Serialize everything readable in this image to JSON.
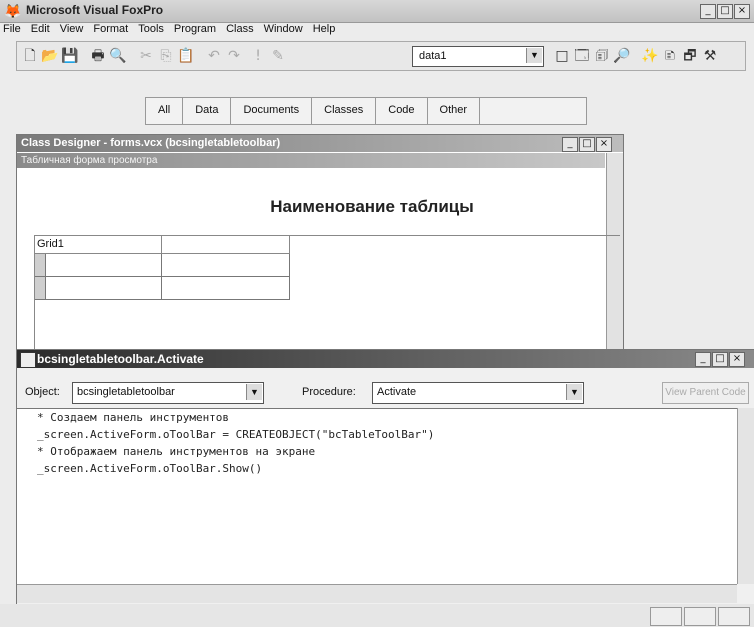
{
  "app": {
    "title": "Microsoft Visual FoxPro"
  },
  "window_controls": {
    "minimize": "_",
    "maximize": "□",
    "close": "×"
  },
  "menu": {
    "items": [
      "File",
      "Edit",
      "View",
      "Format",
      "Tools",
      "Program",
      "Class",
      "Window",
      "Help"
    ]
  },
  "toolbar": {
    "combo_value": "data1",
    "icons": [
      "new-icon",
      "open-icon",
      "save-icon",
      "print-icon",
      "print-preview-icon",
      "cut-icon",
      "copy-icon",
      "paste-icon",
      "undo-icon",
      "redo-icon",
      "run-icon",
      "modify-icon",
      "command-window-icon",
      "view-window-icon",
      "properties-icon",
      "code-icon",
      "form-wizard-icon",
      "builder-icon",
      "toolbox-icon",
      "tools-icon"
    ]
  },
  "tabs": [
    "All",
    "Data",
    "Documents",
    "Classes",
    "Code",
    "Other"
  ],
  "class_designer": {
    "title": "Class Designer - forms.vcx (bcsingletabletoolbar)",
    "form_title": "Табличная форма просмотра",
    "heading": "Наименование таблицы",
    "grid_caption": "Grid1"
  },
  "code_window": {
    "title": "bcsingletabletoolbar.Activate",
    "object_label": "Object:",
    "object_value": "bcsingletabletoolbar",
    "procedure_label": "Procedure:",
    "procedure_value": "Activate",
    "view_parent_code": "View Parent Code",
    "lines": [
      "* Создаем панель инструментов",
      "_screen.ActiveForm.oToolBar = CREATEOBJECT(\"bcTableToolBar\")",
      "* Отображаем панель инструментов на экране",
      "_screen.ActiveForm.oToolBar.Show()"
    ]
  }
}
